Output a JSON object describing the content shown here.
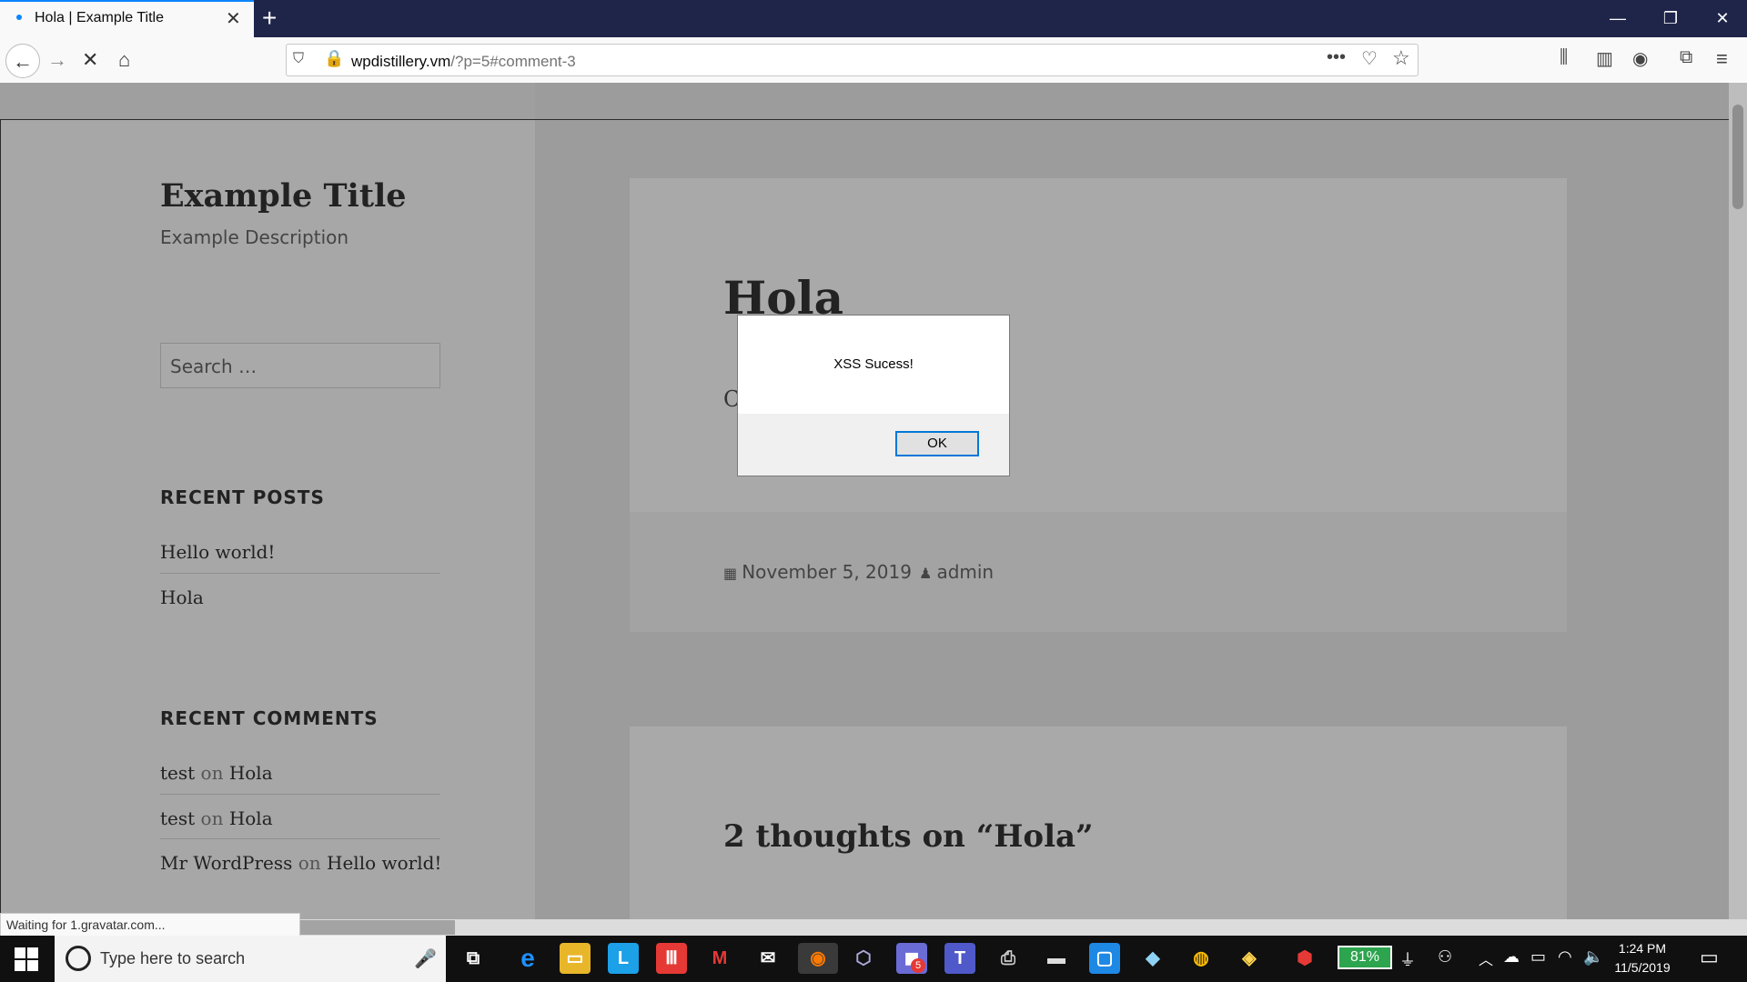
{
  "browser": {
    "tab_title": "Hola | Example Title",
    "url_host": "wpdistillery.vm",
    "url_path": "/?p=5#comment-3",
    "status_text": "Waiting for 1.gravatar.com..."
  },
  "site": {
    "title": "Example Title",
    "description": "Example Description",
    "search_placeholder": "Search …"
  },
  "widgets": {
    "recent_posts_title": "RECENT POSTS",
    "recent_posts": [
      "Hello world!",
      "Hola"
    ],
    "recent_comments_title": "RECENT COMMENTS",
    "recent_comments": [
      {
        "author": "test",
        "on": "on",
        "post": "Hola"
      },
      {
        "author": "test",
        "on": "on",
        "post": "Hola"
      },
      {
        "author": "Mr WordPress",
        "on": "on",
        "post": "Hello world!"
      }
    ]
  },
  "post": {
    "title": "Hola",
    "content_partial": "C",
    "date": "November 5, 2019",
    "author": "admin",
    "comments_heading": "2 thoughts on “Hola”"
  },
  "dialog": {
    "message": "XSS Sucess!",
    "ok_label": "OK"
  },
  "taskbar": {
    "search_placeholder": "Type here to search",
    "battery": "81%",
    "time": "1:24 PM",
    "date": "11/5/2019",
    "badge_count": "5"
  },
  "colors": {
    "accent": "#0a84ff",
    "titlebar": "#1f2449",
    "taskbar": "#101010"
  }
}
